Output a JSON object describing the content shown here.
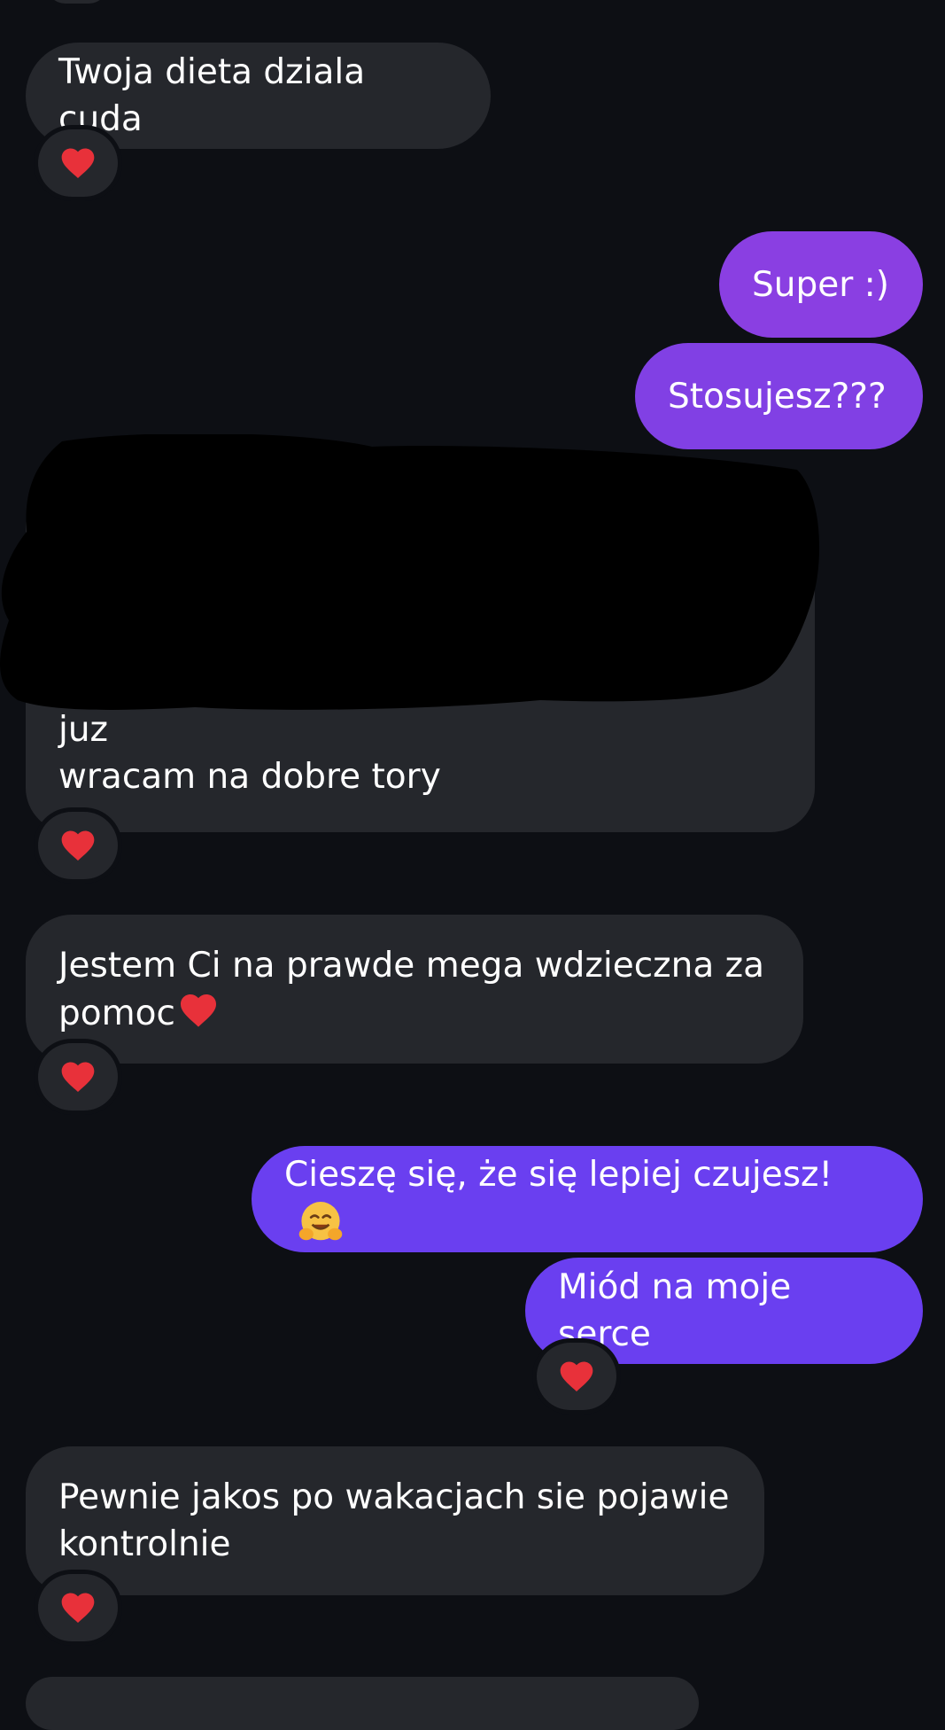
{
  "conversation": {
    "messages": [
      {
        "side": "incoming",
        "text": "Twoja dieta dziala cuda",
        "reaction": "heart"
      },
      {
        "side": "outgoing",
        "text": "Super :)"
      },
      {
        "side": "outgoing",
        "text": "Stosujesz???"
      },
      {
        "side": "incoming",
        "redacted": true,
        "text": "Mialam kryzys diety przez miesiac, ale juz\nwracam na dobre tory",
        "reaction": "heart"
      },
      {
        "side": "incoming",
        "text": "Jestem Ci na prawde mega wdzieczna za\npomoc",
        "inline_emoji": "heart",
        "reaction": "heart"
      },
      {
        "side": "outgoing",
        "text": "Cieszę się, że się lepiej czujesz!",
        "inline_emoji": "hugging-face"
      },
      {
        "side": "outgoing",
        "text": "Miód na moje serce",
        "reaction": "heart"
      },
      {
        "side": "incoming",
        "text": "Pewnie jakos po wakacjach sie pojawie\nkontrolnie",
        "reaction": "heart"
      }
    ]
  },
  "colors": {
    "background": "#0d0f14",
    "incoming_bubble": "#25272c",
    "outgoing_bubble_top": "#8e3fe0",
    "outgoing_bubble_bottom": "#6a3ff0",
    "heart": "#e8313a",
    "redaction": "#000000"
  }
}
